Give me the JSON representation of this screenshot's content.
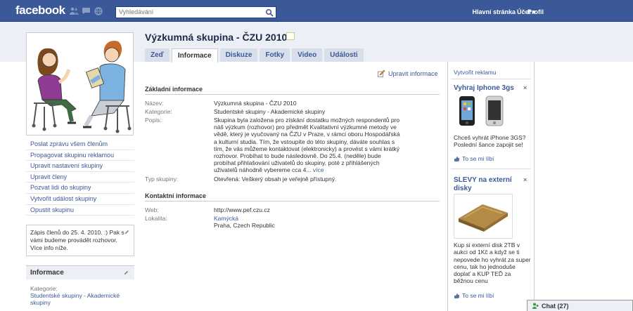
{
  "topbar": {
    "logo": "facebook",
    "search_placeholder": "Vyhledávání",
    "nav": [
      "Hlavní stránka",
      "Profil"
    ],
    "account": "Účet ▾"
  },
  "group": {
    "title": "Výzkumná skupina - ČZU 2010",
    "tabs": [
      "Zeď",
      "Informace",
      "Diskuze",
      "Fotky",
      "Video",
      "Události"
    ],
    "active_tab": "Informace"
  },
  "left": {
    "links": [
      "Poslat zprávu všem členům",
      "Propagovat skupinu reklamou",
      "Upravit nastavení skupiny",
      "Upravit členy",
      "Pozvat lidi do skupiny",
      "Vytvořit událost skupiny",
      "Opustit skupinu"
    ],
    "status": "Zápis členů do 25. 4. 2010. :) Pak s vámi budeme provádět rozhovor. Více info níže.",
    "info_header": "Informace",
    "category_label": "Kategorie:",
    "category_value": "Studentské skupiny - Akademické skupiny"
  },
  "main": {
    "edit_info": "Upravit informace",
    "basic_header": "Základní informace",
    "basic": [
      {
        "k": "Název:",
        "v": "Výzkumná skupina - ČZU 2010"
      },
      {
        "k": "Kategorie:",
        "v": "Studentské skupiny - Akademické skupiny"
      },
      {
        "k": "Popis:",
        "v": "Skupina byla založena pro získání dostatku možných respondentů pro náš výzkum (rozhovor) pro předmět Kvalitativní výzkumné metody ve vědě, který je vyučovaný na ČZU v Praze, v rámci oboru Hospodářská a kulturní studia. Tím, že vstoupíte do této skupiny, dáváte souhlas s tím, že vás můžeme kontaktovat (elektronicky) a provést s vámi krátký rozhovor. Probíhat to bude následovně. Do 25.4. (neděle) bude probíhat přihlašování uživatelů do skupiny, poté z přihlášených uživatelů náhodně vybereme cca 4..."
      },
      {
        "k": "Typ skupiny:",
        "v": "Otevřená: Veškerý obsah je veřejně přístupný."
      }
    ],
    "more": "více",
    "contact_header": "Kontaktní informace",
    "contact": [
      {
        "k": "Web:",
        "v": "http://www.pef.czu.cz"
      },
      {
        "k": "Lokalita:",
        "v": "Kamýcká"
      }
    ],
    "location_city": "Praha, Czech Republic"
  },
  "ads": {
    "create": "Vytvořit reklamu",
    "items": [
      {
        "title": "Vyhraj Iphone 3gs",
        "text": "Chceš vyhrát iPhone 3GS? Poslední šance zapojit se!",
        "like": "To se mi líbí"
      },
      {
        "title": "SLEVY na externí disky",
        "text": "Kup si externí disk 2TB v aukci od 1Kč a když se ti nepovede ho vyhrát za super cenu, tak ho jednoduše doplať a KUP TEĎ za běžnou cenu",
        "like": "To se mi líbí"
      }
    ],
    "close": "×"
  },
  "chat": {
    "label": "Chat (27)"
  },
  "colors": {
    "brand": "#3b5998",
    "light": "#eceff5",
    "tab": "#d8dfea"
  }
}
